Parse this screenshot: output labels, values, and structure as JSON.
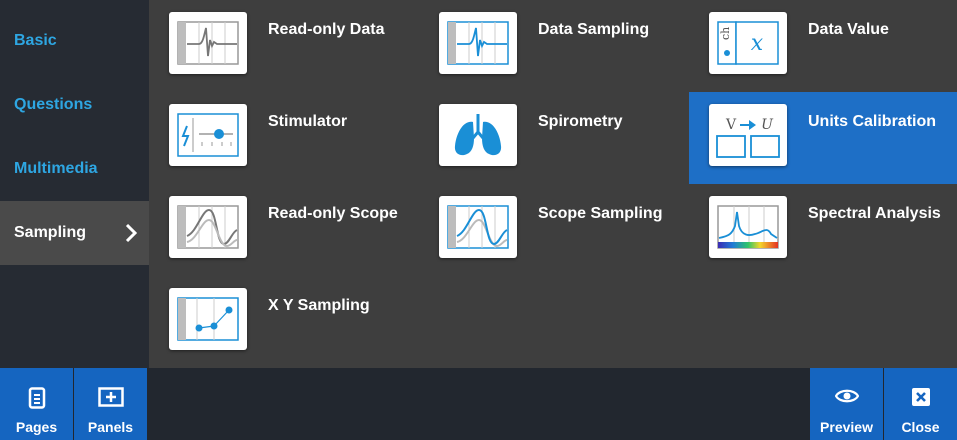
{
  "sidebar": {
    "categories": [
      {
        "label": "Basic"
      },
      {
        "label": "Questions"
      },
      {
        "label": "Multimedia"
      },
      {
        "label": "Sampling",
        "active": true
      }
    ]
  },
  "panels": [
    {
      "label": "Read-only Data",
      "icon": "read-only-data-icon"
    },
    {
      "label": "Data Sampling",
      "icon": "data-sampling-icon"
    },
    {
      "label": "Data Value",
      "icon": "data-value-icon"
    },
    {
      "label": "Stimulator",
      "icon": "stimulator-icon"
    },
    {
      "label": "Spirometry",
      "icon": "lungs-icon"
    },
    {
      "label": "Units Calibration",
      "icon": "units-calibration-icon",
      "selected": true
    },
    {
      "label": "Read-only Scope",
      "icon": "read-only-scope-icon"
    },
    {
      "label": "Scope Sampling",
      "icon": "scope-sampling-icon"
    },
    {
      "label": "Spectral Analysis",
      "icon": "spectral-analysis-icon"
    },
    {
      "label": "X Y Sampling",
      "icon": "xy-sampling-icon"
    }
  ],
  "tile_text": {
    "data_value_unit": "ch",
    "data_value_symbol": "x",
    "calib_from": "V",
    "calib_to": "U"
  },
  "bottom_bar": {
    "pages": "Pages",
    "panels": "Panels",
    "preview": "Preview",
    "close": "Close"
  },
  "colors": {
    "accent": "#2ea6e2",
    "selected": "#1e6fc6",
    "button": "#1565c0",
    "sidebar": "#262b33"
  }
}
